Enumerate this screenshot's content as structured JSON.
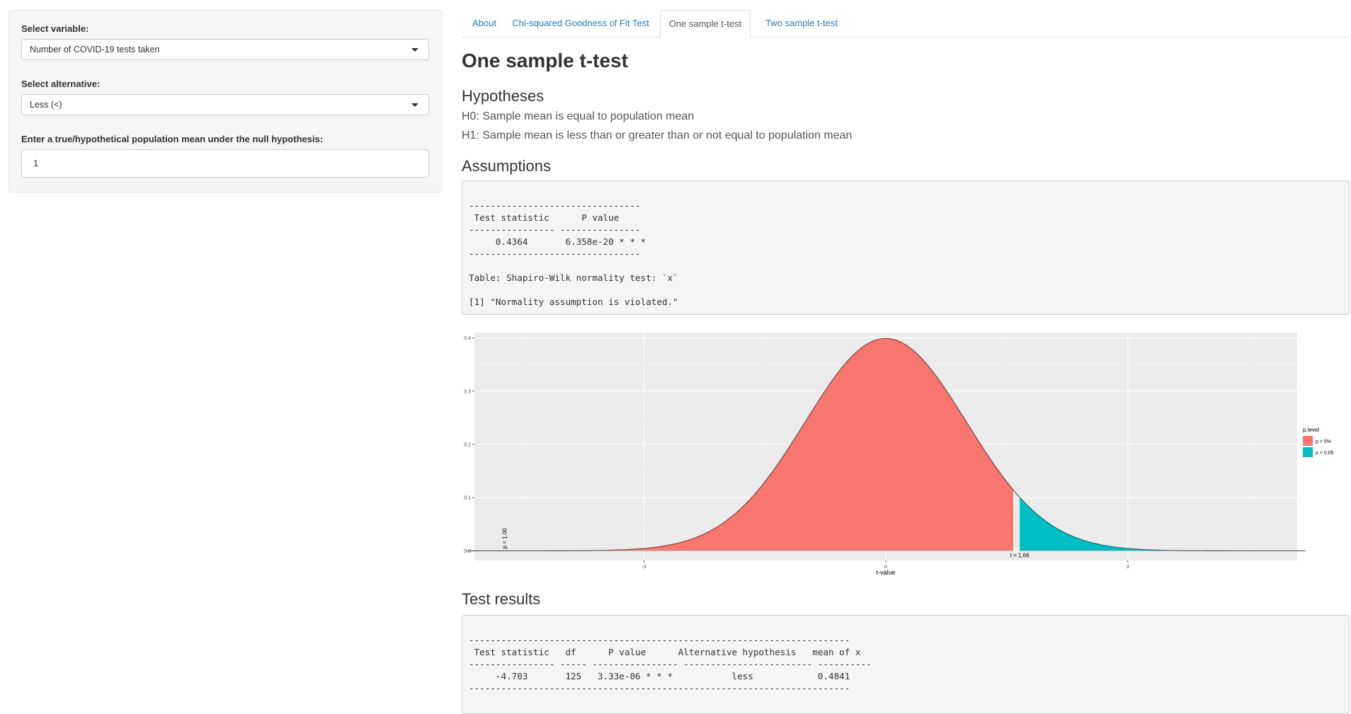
{
  "sidebar": {
    "variable": {
      "label": "Select variable:",
      "value": "Number of COVID-19 tests taken"
    },
    "alternative": {
      "label": "Select alternative:",
      "value": "Less (<)"
    },
    "mean": {
      "label": "Enter a true/hypothetical population mean under the null hypothesis:",
      "value": "1"
    }
  },
  "tabs": [
    "About",
    "Chi-squared Goodness of Fit Test",
    "One sample t-test",
    "Two sample t-test"
  ],
  "active_tab": "One sample t-test",
  "main": {
    "title": "One sample t-test",
    "hypotheses_heading": "Hypotheses",
    "h0": "H0: Sample mean is equal to population mean",
    "h1": "H1: Sample mean is less than or greater than or not equal to population mean",
    "assumptions_heading": "Assumptions",
    "assumptions_output": "\n--------------------------------\n Test statistic      P value    \n---------------- ---------------\n     0.4364       6.358e-20 * * *\n--------------------------------\n\nTable: Shapiro-Wilk normality test: `x`\n\n[1] \"Normality assumption is violated.\"",
    "results_heading": "Test results",
    "results_output": "\n-----------------------------------------------------------------------\n Test statistic   df      P value      Alternative hypothesis   mean of x\n---------------- ----- ---------------- ------------------------ ----------\n     -4.703       125   3.33e-06 * * *           less            0.4841\n-----------------------------------------------------------------------"
  },
  "chart_data": {
    "type": "area",
    "description_curve": "t-distribution density",
    "xlabel": "t-value",
    "ylabel": "",
    "xlim": [
      -5.1,
      5.1
    ],
    "ylim": [
      -0.018,
      0.41
    ],
    "x_ticks": [
      -3,
      0,
      3
    ],
    "x_tick_labels": [
      "-3",
      "0",
      "3"
    ],
    "y_ticks": [
      0.0,
      0.1,
      0.2,
      0.3,
      0.4
    ],
    "y_tick_labels": [
      "0.0",
      "0.1",
      "0.2",
      "0.3",
      "0.4"
    ],
    "curve_range": [
      -5.2,
      5.2
    ],
    "t_stat": 1.66,
    "critical_value": 1.66,
    "series": [
      {
        "name": "p > 5%",
        "x_range": [
          -5.2,
          1.58
        ],
        "color": "#F8766D"
      },
      {
        "name": "p < 0.05",
        "x_range": [
          1.66,
          5.2
        ],
        "color": "#00BFC4"
      }
    ],
    "legend_title": "p.level",
    "legend_position": "right",
    "annotations": [
      {
        "text": "p = 1.00",
        "x": -4.7,
        "y": 0.0,
        "rotation": -90
      },
      {
        "text": "t = 1.66",
        "x": 1.66,
        "y": 0.0
      }
    ],
    "grid": true,
    "colors": {
      "panel": "#EBEBEB",
      "grid": "#FFFFFF",
      "curve": "#555555"
    }
  }
}
